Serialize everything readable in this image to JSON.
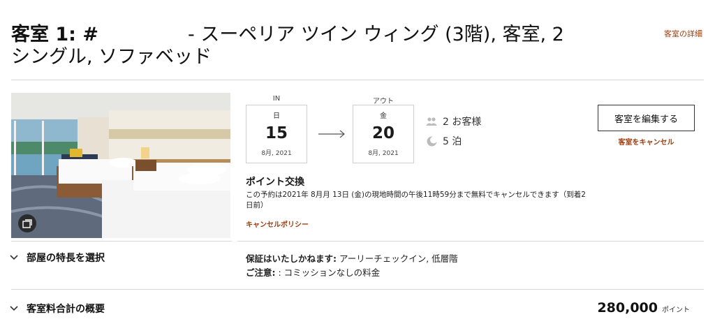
{
  "room": {
    "title_num": "客室 1: #",
    "title_rest": "- スーペリア ツイン ウィング (3階), 客室, 2 シングル, ソファベッド",
    "details_link": "客室の詳細"
  },
  "checkin": {
    "caption": "IN",
    "dow": "日",
    "day": "15",
    "month_year": "8月, 2021"
  },
  "checkout": {
    "caption": "アウト",
    "dow": "金",
    "day": "20",
    "month_year": "8月, 2021"
  },
  "guests_label": "2 お客様",
  "nights_label": "5 泊",
  "buttons": {
    "edit_room": "客室を編集する",
    "cancel_room": "客室をキャンセル"
  },
  "rate": {
    "title": "ポイント交換",
    "policy_text": "この予約は2021年 8月月 13日 (金)の現地時間の午後11時59分まで無料でキャンセルできます（到着2日前）",
    "policy_link": "キャンセルポリシー"
  },
  "features": {
    "accordion_label": "部屋の特長を選択",
    "guarantee_label": "保証はいたしかねます:",
    "guarantee_value": "アーリーチェックイン, 低層階",
    "note_label": "ご注意:",
    "note_value": ": コミッションなしの料金"
  },
  "summary": {
    "accordion_label": "客室料合計の概要",
    "total": "280,000",
    "unit": "ポイント"
  },
  "colors": {
    "accent": "#9c3d10",
    "rule": "#d6d6d6"
  },
  "icons": {
    "guests": "people-icon",
    "nights": "moon-icon",
    "gallery": "gallery-icon",
    "expand": "chevron-down-icon",
    "arrow": "arrow-right-icon"
  }
}
